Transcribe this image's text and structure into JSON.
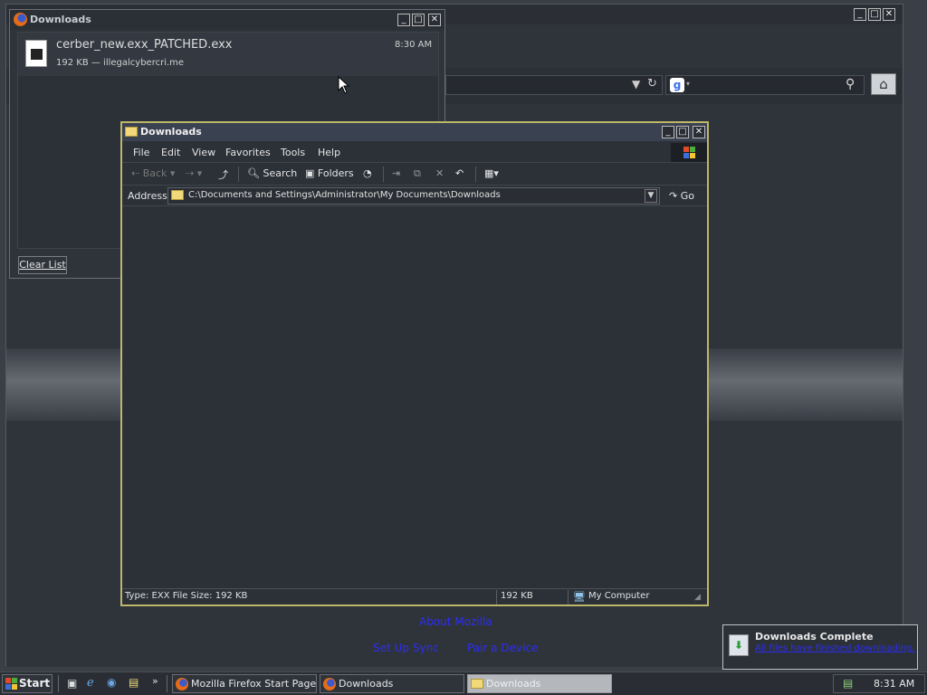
{
  "colors": {
    "desktop": "#3a3f47",
    "explorer_border": "#bdb76b",
    "link_blue": "#2d2df0",
    "active_task": "#b4b8bd"
  },
  "firefox": {
    "search_engine_icon": "google-g-icon",
    "links": {
      "about": "About Mozilla",
      "sync": "Set Up Sync",
      "pair": "Pair a Device"
    }
  },
  "ff_downloads": {
    "title": "Downloads",
    "item": {
      "filename": "cerber_new.exx_PATCHED.exx",
      "details": "192 KB — illegalcybercri.me",
      "time": "8:30 AM"
    },
    "clear_button": "Clear List"
  },
  "explorer": {
    "title": "Downloads",
    "menu": [
      "File",
      "Edit",
      "View",
      "Favorites",
      "Tools",
      "Help"
    ],
    "toolbar": {
      "back": "Back",
      "search": "Search",
      "folders": "Folders"
    },
    "address": {
      "label": "Address",
      "value": "C:\\Documents and Settings\\Administrator\\My Documents\\Downloads",
      "go": "Go"
    },
    "status": {
      "type_info": "Type: EXX File Size: 192 KB",
      "size": "192 KB",
      "zone": "My Computer"
    }
  },
  "taskbar": {
    "start": "Start",
    "tasks": [
      {
        "label": "Mozilla Firefox Start Page..."
      },
      {
        "label": "Downloads"
      },
      {
        "label": "Downloads"
      }
    ],
    "clock": "8:31 AM"
  },
  "notification": {
    "title": "Downloads Complete",
    "message": "All files have finished downloading."
  }
}
